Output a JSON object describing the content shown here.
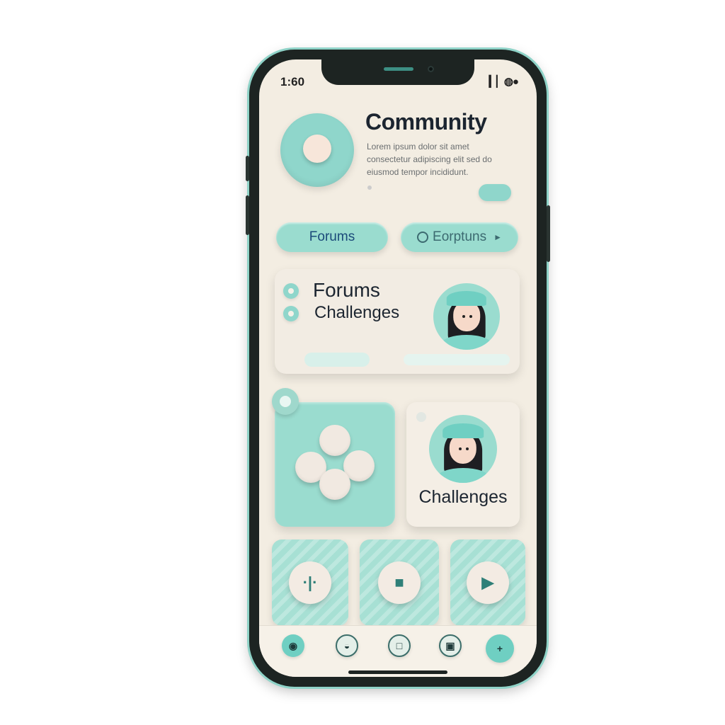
{
  "status_bar": {
    "time": "1:60",
    "icons": "▎▏◍●"
  },
  "header": {
    "title": "Community",
    "description": "Lorem ipsum dolor sit amet consectetur adipiscing elit sed do eiusmod tempor incididunt.",
    "more_label": ""
  },
  "pills": [
    {
      "label": "Forums"
    },
    {
      "label": "Eorptuns"
    }
  ],
  "feature_card": {
    "line1": "Forums",
    "line2": "Challenges",
    "sub": "",
    "button_label": ""
  },
  "tiles": {
    "right_label": "Challenges"
  },
  "shortcuts": [
    {
      "glyph": "·|·",
      "icon": "split-icon"
    },
    {
      "glyph": "■",
      "icon": "book-icon"
    },
    {
      "glyph": "▶",
      "icon": "video-icon"
    }
  ],
  "tabs": [
    {
      "label": "",
      "glyph": "◉",
      "icon": "home-icon"
    },
    {
      "label": "",
      "glyph": "◒",
      "icon": "explore-icon"
    },
    {
      "label": "",
      "glyph": "□",
      "icon": "document-icon"
    },
    {
      "label": "",
      "glyph": "▣",
      "icon": "media-icon"
    },
    {
      "label": "",
      "glyph": "+",
      "icon": "add-icon"
    }
  ],
  "colors": {
    "accent": "#8fd6cb",
    "background": "#f3ede2",
    "frame": "#1d2422",
    "text": "#1c2530"
  }
}
